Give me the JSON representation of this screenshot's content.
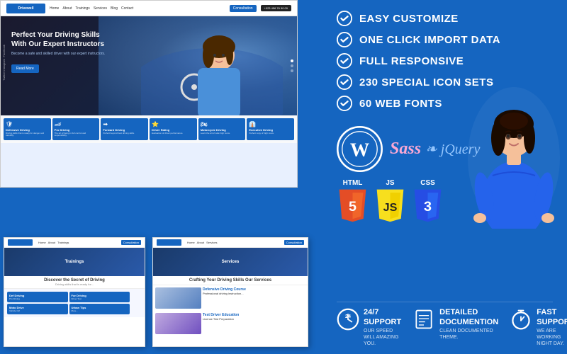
{
  "features": [
    {
      "label": "EASY CUSTOMIZE"
    },
    {
      "label": "ONE CLICK IMPORT DATA"
    },
    {
      "label": "FULL RESPONSIVE"
    },
    {
      "label": "230 SPECIAL ICON SETS"
    },
    {
      "label": "60 WEB FONTS"
    }
  ],
  "hero": {
    "title": "Perfect Your Driving Skills\nWith Our Expert Instructors",
    "subtitle": "Become a safe and skilled driver with our expert instructors.",
    "cta": "Read More"
  },
  "services": [
    {
      "title": "Defensive Driving",
      "desc": "Driving skills that is ready for danger and carefully."
    },
    {
      "title": "Pro Driving",
      "desc": "The art of being in full control and responsibility."
    },
    {
      "title": "Forward Driving",
      "desc": "Perfect beyond best driving skills."
    },
    {
      "title": "Driver Rating",
      "desc": "Evaluation of driver performance."
    },
    {
      "title": "Motorcycle Driving",
      "desc": "Learn the art of safe high curve."
    },
    {
      "title": "Executive Driving",
      "desc": "Perfect copy of high curve."
    }
  ],
  "mini_trainings": {
    "title": "Trainings",
    "subtitle": "Discover the Secret of Driving"
  },
  "mini_services": {
    "title": "Services",
    "subtitle": "Crafting Your Driving Skills Our Services"
  },
  "tech": {
    "wordpress": "WP",
    "sass": "Sass",
    "jquery": "jQuery",
    "html": "HTML",
    "js": "JS",
    "css": "CSS",
    "html_num": "5",
    "js_num": "JS",
    "css_num": "3"
  },
  "bottom": [
    {
      "title": "24/7 SUPPORT",
      "subtitle": "OUR SPEED WILL AMAZING YOU.",
      "icon": "clock-24"
    },
    {
      "title": "DETAILED DOCUMENTION",
      "subtitle": "CLEAN DOCUMENTED THEME.",
      "icon": "document"
    },
    {
      "title": "FAST SUPPORT",
      "subtitle": "WE ARE WORKING NIGHT DAY.",
      "icon": "timer"
    }
  ],
  "nav": {
    "logo": "Drivewell",
    "links": [
      "Home",
      "About",
      "Trainings",
      "Services",
      "Blog",
      "Contact"
    ]
  },
  "social": [
    "Facebook",
    "Instagram",
    "Twitter"
  ]
}
